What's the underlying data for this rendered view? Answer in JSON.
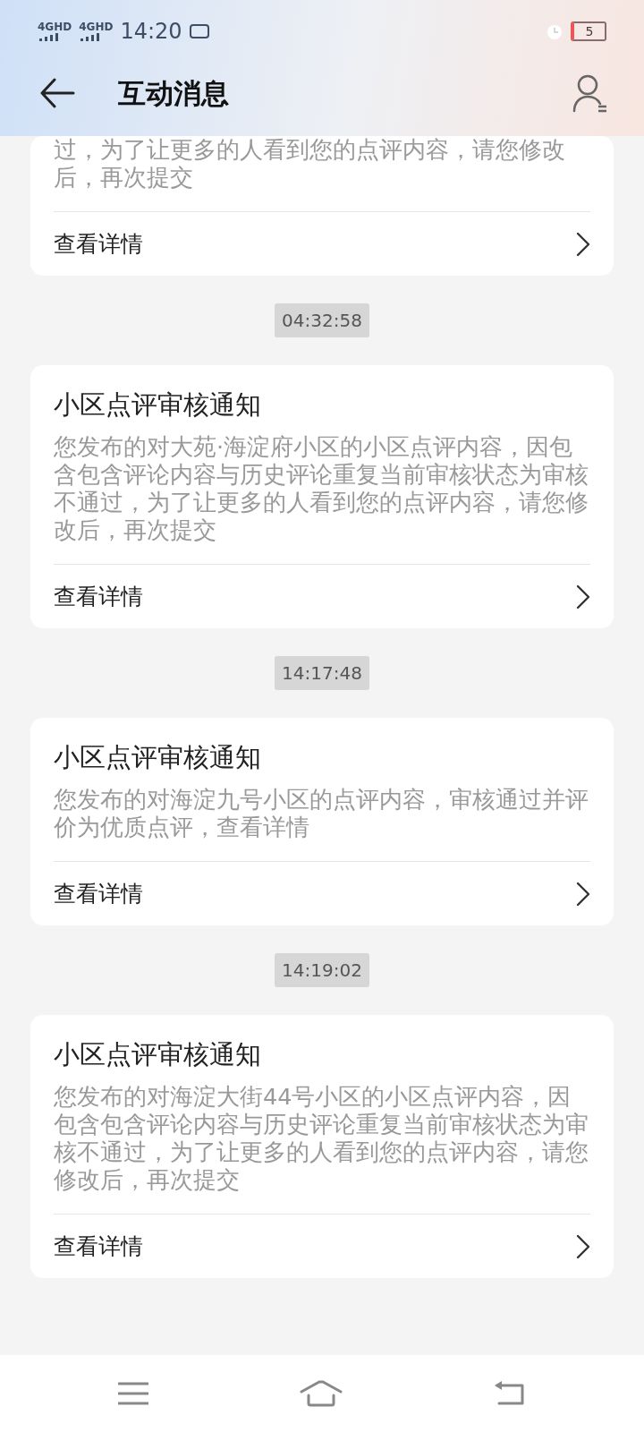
{
  "status_bar": {
    "networks": [
      "4GHD",
      "4GHD"
    ],
    "time": "14:20",
    "battery": "5"
  },
  "header": {
    "title": "互动消息"
  },
  "partial_card": {
    "body": "过，为了让更多的人看到您的点评内容，请您修改后，再次提交",
    "link": "查看详情"
  },
  "messages": [
    {
      "time": "04:32:58",
      "title": "小区点评审核通知",
      "body": "您发布的对大苑·海淀府小区的小区点评内容，因包含包含评论内容与历史评论重复当前审核状态为审核不通过，为了让更多的人看到您的点评内容，请您修改后，再次提交",
      "link": "查看详情"
    },
    {
      "time": "14:17:48",
      "title": "小区点评审核通知",
      "body": "您发布的对海淀九号小区的点评内容，审核通过并评价为优质点评，查看详情",
      "link": "查看详情"
    },
    {
      "time": "14:19:02",
      "title": "小区点评审核通知",
      "body": "您发布的对海淀大街44号小区的小区点评内容，因包含包含评论内容与历史评论重复当前审核状态为审核不通过，为了让更多的人看到您的点评内容，请您修改后，再次提交",
      "link": "查看详情"
    }
  ]
}
